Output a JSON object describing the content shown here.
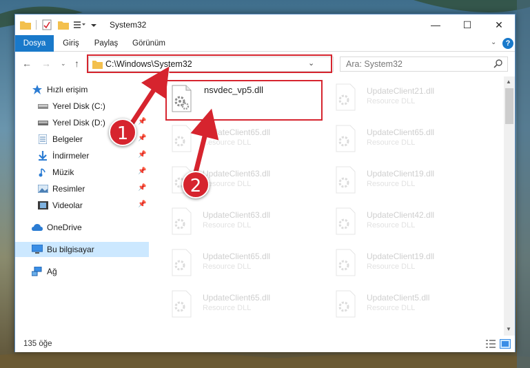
{
  "window": {
    "title": "System32",
    "controls": {
      "minimize": "—",
      "maximize": "☐",
      "close": "✕"
    }
  },
  "ribbon": {
    "tabs": [
      "Dosya",
      "Giriş",
      "Paylaş",
      "Görünüm"
    ],
    "help": "?"
  },
  "address": {
    "path": "C:\\Windows\\System32",
    "dropdown": "⌄",
    "refresh": "↻"
  },
  "search": {
    "placeholder": "Ara: System32"
  },
  "nav": {
    "quick_access": "Hızlı erişim",
    "items": [
      {
        "label": "Yerel Disk (C:)",
        "icon": "drive-icon",
        "pinned": false
      },
      {
        "label": "Yerel Disk (D:)",
        "icon": "drive-icon",
        "pinned": true
      },
      {
        "label": "Belgeler",
        "icon": "documents-icon",
        "pinned": true
      },
      {
        "label": "İndirmeler",
        "icon": "download-icon",
        "pinned": true
      },
      {
        "label": "Müzik",
        "icon": "music-icon",
        "pinned": true
      },
      {
        "label": "Resimler",
        "icon": "pictures-icon",
        "pinned": true
      },
      {
        "label": "Videolar",
        "icon": "video-icon",
        "pinned": true
      }
    ],
    "onedrive": "OneDrive",
    "this_pc": "Bu bilgisayar",
    "network": "Ağ"
  },
  "files": {
    "highlighted": {
      "name": "nsvdec_vp5.dll",
      "type": ""
    },
    "left_column": [
      {
        "name": "UpdateClient65.dll",
        "type": "Resource DLL"
      },
      {
        "name": "UpdateClient63.dll",
        "type": "Resource DLL"
      },
      {
        "name": "UpdateClient63.dll",
        "type": "Resource DLL"
      },
      {
        "name": "UpdateClient65.dll",
        "type": "Resource DLL"
      },
      {
        "name": "UpdateClient65.dll",
        "type": "Resource DLL"
      }
    ],
    "right_column": [
      {
        "name": "UpdateClient21.dll",
        "type": "Resource DLL"
      },
      {
        "name": "UpdateClient65.dll",
        "type": "Resource DLL"
      },
      {
        "name": "UpdateClient19.dll",
        "type": "Resource DLL"
      },
      {
        "name": "UpdateClient42.dll",
        "type": "Resource DLL"
      },
      {
        "name": "UpdateClient19.dll",
        "type": "Resource DLL"
      },
      {
        "name": "UpdateClient5.dll",
        "type": "Resource DLL"
      }
    ]
  },
  "status": {
    "count": "135 öğe"
  },
  "callouts": [
    "1",
    "2"
  ],
  "colors": {
    "accent": "#1979ca",
    "highlight_red": "#d6242e",
    "selection": "#cce8ff"
  }
}
